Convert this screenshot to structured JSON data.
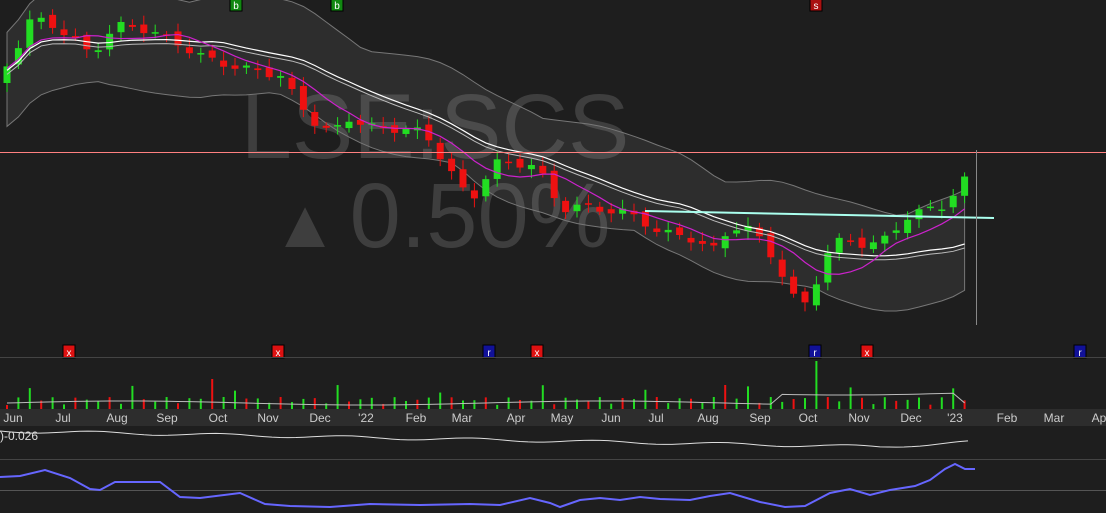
{
  "chart": {
    "symbol": "LSE:SCS",
    "change_arrow": "▲",
    "change_text": "0.50%",
    "sub_label": ")-0.026"
  },
  "colors": {
    "background": "#1e1e1e",
    "up": "#22dd22",
    "down": "#ee1111",
    "bollinger": "#ffffff",
    "ma_fast": "#cc22cc",
    "trendline": "#aaffee",
    "price_line": "#ff8080",
    "rsi": "#6666ff",
    "axis_bg": "#2d2d2d",
    "axis_text": "#cccccc"
  },
  "chart_data": {
    "type": "candlestick",
    "x_axis_labels": [
      "Jun",
      "Jul",
      "Aug",
      "Sep",
      "Oct",
      "Nov",
      "Dec",
      "'22",
      "Feb",
      "Mar",
      "Apr",
      "May",
      "Jun",
      "Jul",
      "Aug",
      "Sep",
      "Oct",
      "Nov",
      "Dec",
      "'23",
      "Feb",
      "Mar",
      "Apr"
    ],
    "signal_markers_top": [
      "b",
      "b",
      "s"
    ],
    "signal_markers_bottom": [
      "x",
      "x",
      "r",
      "x",
      "r",
      "x",
      "r"
    ],
    "last_change_percent": 0.5
  }
}
